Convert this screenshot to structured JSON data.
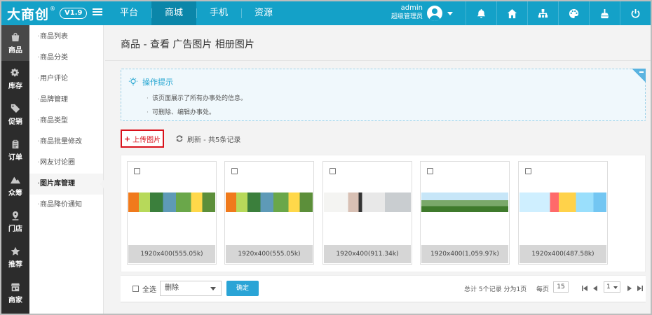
{
  "app": {
    "logo_text": "大商创",
    "logo_reg": "®",
    "version": "V1.9"
  },
  "top_nav": [
    {
      "label": "平台",
      "active": false
    },
    {
      "label": "商城",
      "active": true
    },
    {
      "label": "手机",
      "active": false
    },
    {
      "label": "资源",
      "active": false
    }
  ],
  "user": {
    "name": "admin",
    "role": "超级管理员"
  },
  "top_icons": [
    "bell-icon",
    "home-icon",
    "sitemap-icon",
    "palette-icon",
    "broom-icon",
    "power-icon"
  ],
  "sidebar": [
    {
      "label": "商品",
      "icon": "bag-icon",
      "active": true
    },
    {
      "label": "库存",
      "icon": "cogs-icon",
      "active": false
    },
    {
      "label": "促销",
      "icon": "tag-icon",
      "active": false
    },
    {
      "label": "订单",
      "icon": "clipboard-icon",
      "active": false
    },
    {
      "label": "众筹",
      "icon": "mountain-icon",
      "active": false
    },
    {
      "label": "门店",
      "icon": "map-pin-icon",
      "active": false
    },
    {
      "label": "推荐",
      "icon": "star-icon",
      "active": false
    },
    {
      "label": "商家",
      "icon": "store-icon",
      "active": false
    }
  ],
  "submenu": [
    {
      "label": "商品列表",
      "active": false
    },
    {
      "label": "商品分类",
      "active": false
    },
    {
      "label": "用户评论",
      "active": false
    },
    {
      "label": "品牌管理",
      "active": false
    },
    {
      "label": "商品类型",
      "active": false
    },
    {
      "label": "商品批量修改",
      "active": false
    },
    {
      "label": "网友讨论圈",
      "active": false
    },
    {
      "label": "图片库管理",
      "active": true
    },
    {
      "label": "商品降价通知",
      "active": false
    }
  ],
  "page": {
    "title": "商品 - 查看 广告图片 相册图片"
  },
  "tips": {
    "title": "操作提示",
    "items": [
      "该页面展示了所有办事处的信息。",
      "可删除、编辑办事处。"
    ]
  },
  "toolbar": {
    "upload_label": "上传图片",
    "refresh_label": "刷新 - 共5条记录"
  },
  "images": [
    {
      "caption": "1920x400(555.05k)",
      "banner": "b1",
      "banner_text": ""
    },
    {
      "caption": "1920x400(555.05k)",
      "banner": "b1",
      "banner_text": ""
    },
    {
      "caption": "1920x400(911.34k)",
      "banner": "b2",
      "banner_text": ""
    },
    {
      "caption": "1920x400(1,059.97k)",
      "banner": "b3",
      "banner_text": ""
    },
    {
      "caption": "1920x400(487.58k)",
      "banner": "b4",
      "banner_text": ""
    }
  ],
  "footer": {
    "select_all": "全选",
    "action_select": "删除",
    "confirm": "确定",
    "summary": "总计 5个记录 分为1页",
    "per_page_label": "每页",
    "per_page_value": "15",
    "page_value": "1"
  },
  "colors": {
    "brand": "#14a1c8",
    "accent_red": "#d9111b",
    "button_blue": "#2aa4d6"
  }
}
